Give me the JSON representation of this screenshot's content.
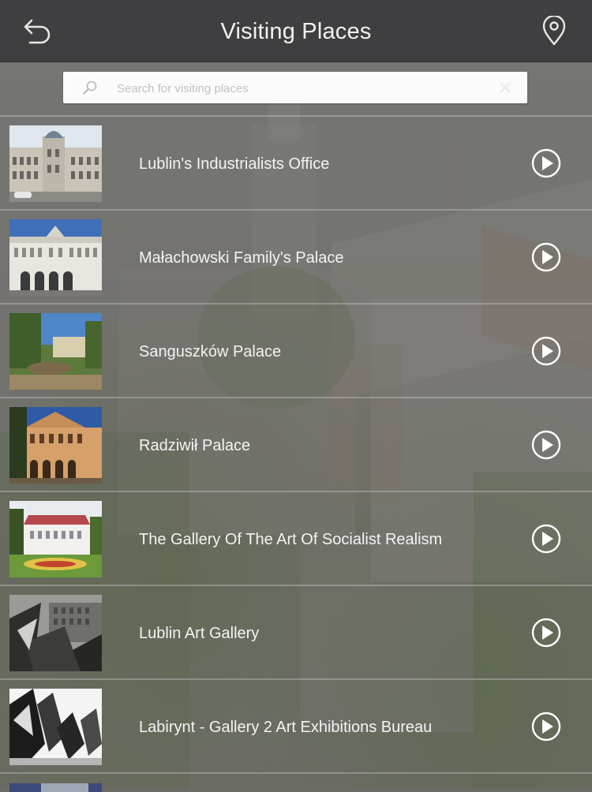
{
  "header": {
    "title": "Visiting Places",
    "back_icon": "back-arrow-icon",
    "map_icon": "map-pin-icon"
  },
  "search": {
    "placeholder": "Search for visiting places",
    "value": "",
    "icon": "search-icon",
    "clear_icon": "clear-icon"
  },
  "places": [
    {
      "name": "Lublin's Industrialists Office",
      "thumb": "ornate-corner-building-photo"
    },
    {
      "name": "Małachowski Family's Palace",
      "thumb": "white-palace-arcade-photo"
    },
    {
      "name": "Sanguszków Palace",
      "thumb": "park-fountain-palace-photo"
    },
    {
      "name": "Radziwił Palace",
      "thumb": "sunlit-palace-facade-photo"
    },
    {
      "name": "The Gallery Of The Art Of Socialist Realism",
      "thumb": "manor-with-flowerbed-photo"
    },
    {
      "name": "Lublin Art Gallery",
      "thumb": "bw-sculpture-street-photo"
    },
    {
      "name": "Labirynt - Gallery 2 Art Exhibitions Bureau",
      "thumb": "bw-abstract-sculpture-photo"
    }
  ],
  "colors": {
    "header_bg": "#3f3f41",
    "text": "#f4f4f4",
    "search_bg": "#fbfbfb"
  }
}
